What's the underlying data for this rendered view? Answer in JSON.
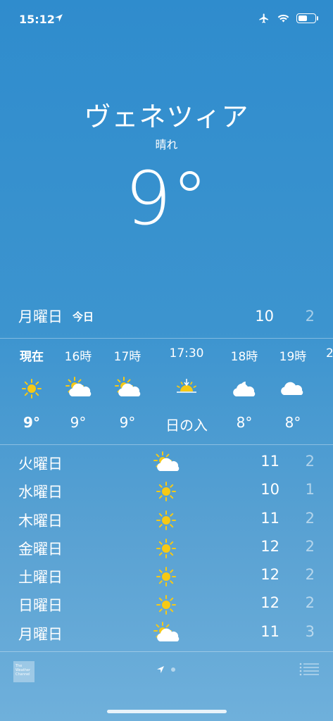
{
  "status_bar": {
    "time": "15:12",
    "battery_level": 0.55
  },
  "location": {
    "city": "ヴェネツィア",
    "condition": "晴れ",
    "temperature": "9°"
  },
  "today": {
    "day": "月曜日",
    "label": "今日",
    "high": "10",
    "low": "2"
  },
  "hourly": [
    {
      "time": "現在",
      "icon": "sun",
      "temp": "9°"
    },
    {
      "time": "16時",
      "icon": "sun-cloud",
      "temp": "9°"
    },
    {
      "time": "17時",
      "icon": "sun-cloud",
      "temp": "9°"
    },
    {
      "time": "17:30",
      "icon": "sunset",
      "temp": "日の入"
    },
    {
      "time": "18時",
      "icon": "moon-cloud",
      "temp": "8°"
    },
    {
      "time": "19時",
      "icon": "cloud",
      "temp": "8°"
    },
    {
      "time": "2",
      "icon": "",
      "temp": ""
    }
  ],
  "daily": [
    {
      "day": "火曜日",
      "icon": "sun-cloud",
      "high": "11",
      "low": "2"
    },
    {
      "day": "水曜日",
      "icon": "sun",
      "high": "10",
      "low": "1"
    },
    {
      "day": "木曜日",
      "icon": "sun",
      "high": "11",
      "low": "2"
    },
    {
      "day": "金曜日",
      "icon": "sun",
      "high": "12",
      "low": "2"
    },
    {
      "day": "土曜日",
      "icon": "sun",
      "high": "12",
      "low": "2"
    },
    {
      "day": "日曜日",
      "icon": "sun",
      "high": "12",
      "low": "2"
    },
    {
      "day": "月曜日",
      "icon": "sun-cloud",
      "high": "11",
      "low": "3"
    }
  ],
  "footer": {
    "provider_logo": "The Weather Channel",
    "pages": 2,
    "current_page": 1
  }
}
